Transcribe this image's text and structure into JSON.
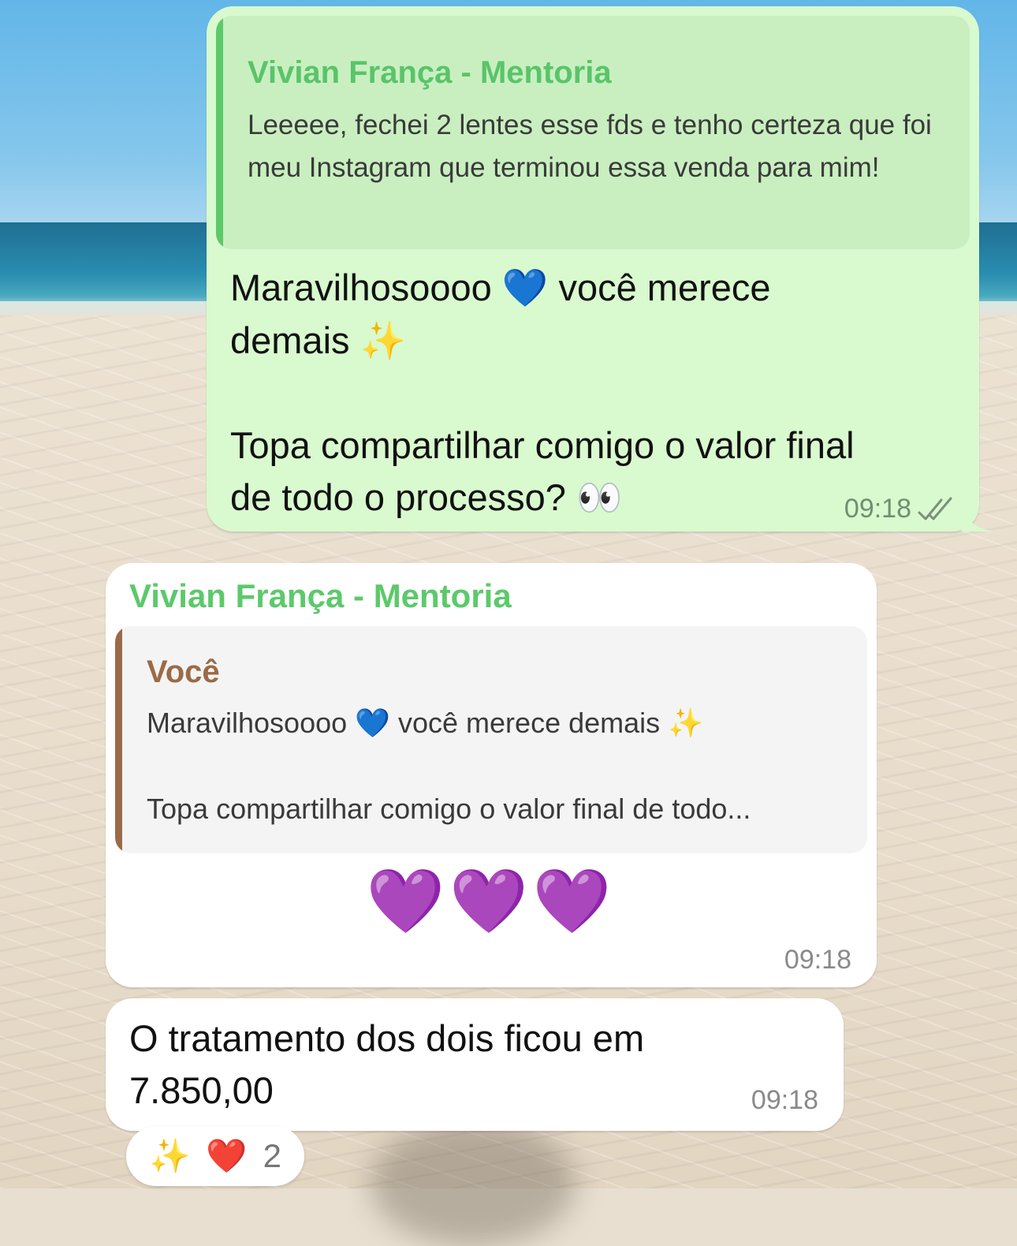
{
  "chat": {
    "outgoing": {
      "quote_author": "Vivian França - Mentoria",
      "quote_text": "Leeeee, fechei 2 lentes esse fds e tenho certeza que foi meu Instagram que terminou essa venda para mim!",
      "line1": "Maravilhosoooo",
      "line1_emoji": "💙",
      "line1_rest": " você merece",
      "line2": "demais",
      "line2_emoji": "✨",
      "line3": "Topa compartilhar comigo o valor final",
      "line4": "de todo o processo?",
      "line4_emoji": "👀",
      "time": "09:18",
      "status": "read"
    },
    "incoming_reply": {
      "sender": "Vivian França - Mentoria",
      "quote_author": "Você",
      "quote_line1": "Maravilhosoooo",
      "quote_emoji1": "💙",
      "quote_line1_rest": " você merece demais",
      "quote_emoji2": "✨",
      "quote_line2": "Topa compartilhar comigo o valor final de todo...",
      "hearts": "💜💜💜",
      "time": "09:18"
    },
    "incoming_msg": {
      "text_line1": "O tratamento dos dois ficou em",
      "text_line2": "7.850,00",
      "time": "09:18"
    },
    "reactions": {
      "emoji1": "✨",
      "emoji2": "❤️",
      "count": "2"
    }
  },
  "colors": {
    "outgoing_bubble": "#d9f9cf",
    "incoming_bubble": "#ffffff",
    "sender_green": "#5cc96b",
    "quote_brown": "#9b6a47"
  }
}
